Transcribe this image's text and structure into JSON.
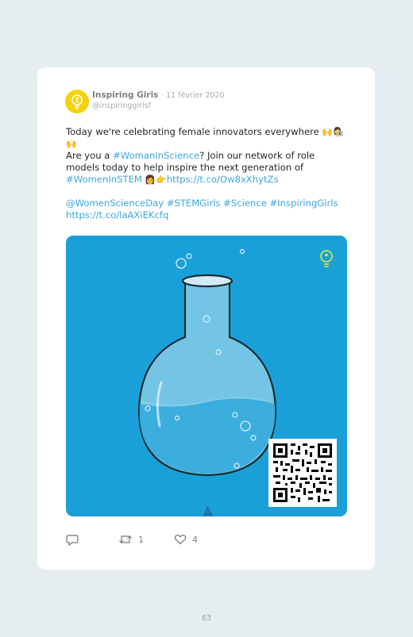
{
  "tweet": {
    "author_name": "Inspiring Girls",
    "date": "· 11 février 2020",
    "handle": "@inspiringgirlsf",
    "line1_text": "Today we're celebrating female innovators everywhere ",
    "line1_emoji": "🙌👩‍🔬",
    "line2_emoji": "🙌",
    "line3_prefix": "Are you a ",
    "line3_tag": "#WomanInScience",
    "line3_suffix": "? Join our network of role",
    "line4_text": "models today to help inspire the next generation of",
    "line5_tag": "#WomenInSTEM",
    "line5_emoji": " 👩👉",
    "line5_link": "https://t.co/Ow8xXhytZs",
    "line6_text": "@WomenScienceDay #STEMGirls #Science #InspiringGirls",
    "line7_link": "https://t.co/laAXiEKcfq"
  },
  "actions": {
    "reply_icon": "reply-icon",
    "retweet_icon": "retweet-icon",
    "retweet_count": "1",
    "like_icon": "heart-icon",
    "like_count": "4"
  },
  "page": {
    "number": "63"
  },
  "colors": {
    "background": "#e6edf0",
    "link": "#3ca7e2",
    "image_background": "#1aa0d8",
    "avatar": "#f6d10c"
  }
}
